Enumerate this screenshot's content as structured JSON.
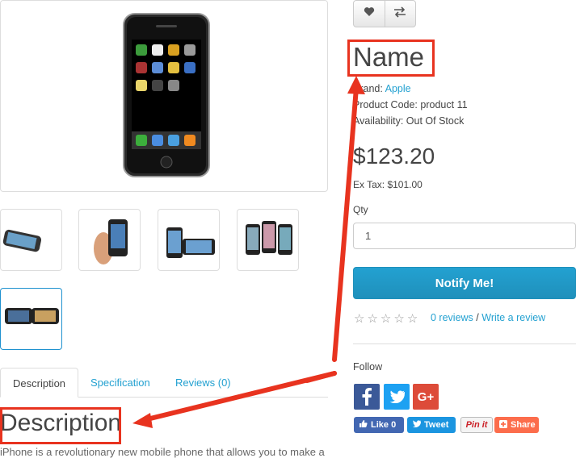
{
  "product": {
    "name": "Name",
    "brand_label": "Brand:",
    "brand_value": "Apple",
    "code_label": "Product Code:",
    "code_value": "product 11",
    "availability_label": "Availability:",
    "availability_value": "Out Of Stock",
    "price": "$123.20",
    "ex_tax": "Ex Tax: $101.00",
    "qty_label": "Qty",
    "qty_value": "1",
    "notify_label": "Notify Me!",
    "reviews_link": "0 reviews",
    "reviews_sep": "/",
    "write_review_link": "Write a review",
    "rating_stars": 0
  },
  "toolbar": {
    "wishlist_icon": "heart-icon",
    "compare_icon": "exchange-icon"
  },
  "tabs": [
    {
      "label": "Description"
    },
    {
      "label": "Specification"
    },
    {
      "label": "Reviews (0)"
    }
  ],
  "description": {
    "heading": "Description",
    "text": "iPhone is a revolutionary new mobile phone that allows you to make a"
  },
  "follow": {
    "label": "Follow",
    "icons": [
      "facebook-icon",
      "twitter-icon",
      "google-plus-icon"
    ],
    "share_buttons": [
      {
        "label": "Like 0"
      },
      {
        "label": "Tweet"
      },
      {
        "label": "Pin it"
      },
      {
        "label": "Share"
      }
    ]
  },
  "colors": {
    "accent": "#23a1d1",
    "annotation_red": "#e8331f",
    "facebook": "#3b5998",
    "twitter": "#1da1f2",
    "google": "#dd4b39"
  }
}
